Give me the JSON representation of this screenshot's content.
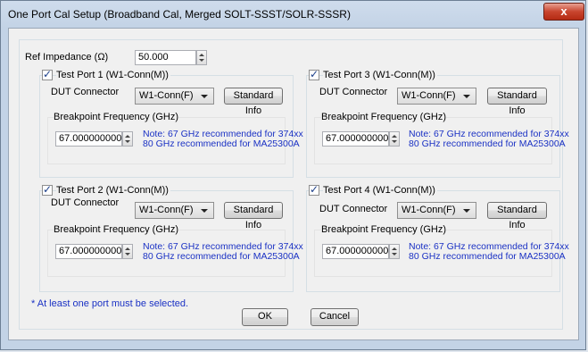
{
  "window": {
    "title": "One Port Cal Setup (Broadband Cal, Merged SOLT-SSST/SOLR-SSSR)",
    "close_glyph": "x"
  },
  "ref_impedance": {
    "label": "Ref Impedance (Ω)",
    "value": "50.000"
  },
  "common": {
    "dut_connector_label": "DUT Connector",
    "standard_info_label": "Standard Info",
    "breakpoint_label": "Breakpoint Frequency (GHz)",
    "note_line1": "Note: 67 GHz recommended for 374xx",
    "note_line2": "80 GHz recommended for MA25300A"
  },
  "ports": [
    {
      "label": "Test Port 1 (W1-Conn(M))",
      "checked": true,
      "connector": "W1-Conn(F)",
      "breakpoint": "67.000000000"
    },
    {
      "label": "Test Port 3 (W1-Conn(M))",
      "checked": true,
      "connector": "W1-Conn(F)",
      "breakpoint": "67.000000000"
    },
    {
      "label": "Test Port 2 (W1-Conn(M))",
      "checked": true,
      "connector": "W1-Conn(F)",
      "breakpoint": "67.000000000"
    },
    {
      "label": "Test Port 4 (W1-Conn(M))",
      "checked": true,
      "connector": "W1-Conn(F)",
      "breakpoint": "67.000000000"
    }
  ],
  "footer": {
    "warning": "* At least one port must be selected.",
    "ok_label": "OK",
    "cancel_label": "Cancel"
  },
  "colors": {
    "note_text": "#1a31c4",
    "close_button": "#c8452e"
  }
}
